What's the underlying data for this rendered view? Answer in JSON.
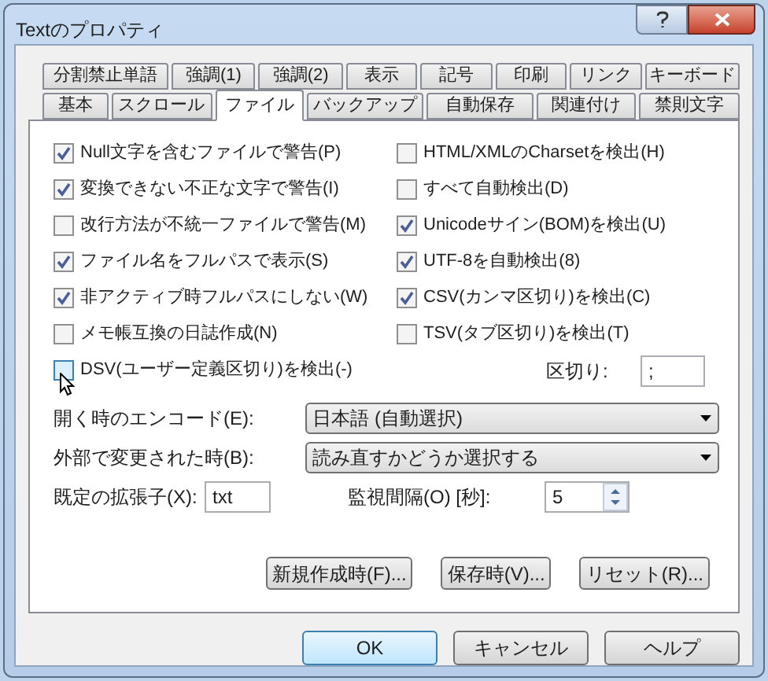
{
  "window": {
    "title": "Textのプロパティ"
  },
  "tab_rows": [
    [
      {
        "label": "分割禁止単語",
        "selected": false
      },
      {
        "label": "強調(1)",
        "selected": false
      },
      {
        "label": "強調(2)",
        "selected": false
      },
      {
        "label": "表示",
        "selected": false
      },
      {
        "label": "記号",
        "selected": false
      },
      {
        "label": "印刷",
        "selected": false
      },
      {
        "label": "リンク",
        "selected": false
      },
      {
        "label": "キーボード",
        "selected": false
      }
    ],
    [
      {
        "label": "基本",
        "selected": false
      },
      {
        "label": "スクロール",
        "selected": false
      },
      {
        "label": "ファイル",
        "selected": true
      },
      {
        "label": "バックアップ",
        "selected": false
      },
      {
        "label": "自動保存",
        "selected": false
      },
      {
        "label": "関連付け",
        "selected": false
      },
      {
        "label": "禁則文字",
        "selected": false
      }
    ]
  ],
  "left_options": [
    {
      "label": "Null文字を含むファイルで警告(P)",
      "checked": true
    },
    {
      "label": "変換できない不正な文字で警告(I)",
      "checked": true
    },
    {
      "label": "改行方法が不統一ファイルで警告(M)",
      "checked": false
    },
    {
      "label": "ファイル名をフルパスで表示(S)",
      "checked": true
    },
    {
      "label": "非アクティブ時フルパスにしない(W)",
      "checked": true
    },
    {
      "label": "メモ帳互換の日誌作成(N)",
      "checked": false
    },
    {
      "label": "DSV(ユーザー定義区切り)を検出(-)",
      "checked": false,
      "hovered": true
    }
  ],
  "right_options": [
    {
      "label": "HTML/XMLのCharsetを検出(H)",
      "checked": false
    },
    {
      "label": "すべて自動検出(D)",
      "checked": false
    },
    {
      "label": "Unicodeサイン(BOM)を検出(U)",
      "checked": true
    },
    {
      "label": "UTF-8を自動検出(8)",
      "checked": true
    },
    {
      "label": "CSV(カンマ区切り)を検出(C)",
      "checked": true
    },
    {
      "label": "TSV(タブ区切り)を検出(T)",
      "checked": false
    }
  ],
  "delimiter": {
    "label": "区切り:",
    "value": ";"
  },
  "dropdowns": [
    {
      "label": "開く時のエンコード(E):",
      "value": "日本語 (自動選択)"
    },
    {
      "label": "外部で変更された時(B):",
      "value": "読み直すかどうか選択する"
    }
  ],
  "extension": {
    "label": "既定の拡張子(X):",
    "value": "txt"
  },
  "interval": {
    "label": "監視間隔(O) [秒]:",
    "value": "5"
  },
  "panel_buttons": [
    "新規作成時(F)...",
    "保存時(V)...",
    "リセット(R)..."
  ],
  "dialog_buttons": [
    {
      "label": "OK",
      "default": true
    },
    {
      "label": "キャンセル",
      "default": false
    },
    {
      "label": "ヘルプ",
      "default": false
    }
  ]
}
